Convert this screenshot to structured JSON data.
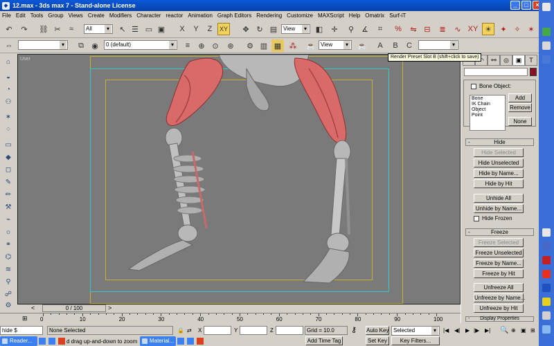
{
  "window": {
    "title": "12.max - 3ds max 7 - Stand-alone License",
    "app_icon": "3ds-max-icon"
  },
  "menu": [
    "File",
    "Edit",
    "Tools",
    "Group",
    "Views",
    "Create",
    "Modifiers",
    "Character",
    "reactor",
    "Animation",
    "Graph Editors",
    "Rendering",
    "Customize",
    "MAXScript",
    "Help",
    "Omatrix",
    "Surf-iT"
  ],
  "toolbar": {
    "selection_filter": "All",
    "ref_coord": "View",
    "layer": "0 (default)",
    "render_view": "View",
    "named_sel": "",
    "axis_x": "X",
    "axis_y": "Y",
    "axis_z": "Z",
    "axis_xy": "XY",
    "tooltip": "Render Preset Slot B (shift+click to save)"
  },
  "viewport": {
    "label": "User"
  },
  "command_panel": {
    "tab_icons": [
      "create-icon",
      "modify-icon",
      "hierarchy-icon",
      "motion-icon",
      "display-icon",
      "utilities-icon"
    ],
    "bone_object_label": "Bone Object:",
    "list_items": [
      "Bone",
      "IK Chain Object",
      "Point"
    ],
    "add": "Add",
    "remove": "Remove",
    "none": "None",
    "hide": {
      "title": "Hide",
      "hide_selected": "Hide Selected",
      "hide_unselected": "Hide Unselected",
      "hide_by_name": "Hide by Name...",
      "hide_by_hit": "Hide by Hit",
      "unhide_all": "Unhide All",
      "unhide_by_name": "Unhide by Name...",
      "hide_frozen": "Hide Frozen"
    },
    "freeze": {
      "title": "Freeze",
      "freeze_selected": "Freeze Selected",
      "freeze_unselected": "Freeze Unselected",
      "freeze_by_name": "Freeze by Name...",
      "freeze_by_hit": "Freeze by Hit",
      "unfreeze_all": "Unfreeze All",
      "unfreeze_by_name": "Unfreeze by Name...",
      "unfreeze_by_hit": "Unfreeze by Hit"
    },
    "display_properties": "Display Properties"
  },
  "timeline": {
    "slider": "0 / 100",
    "ticks": [
      "0",
      "10",
      "20",
      "30",
      "40",
      "50",
      "60",
      "70",
      "80",
      "90",
      "100"
    ]
  },
  "status": {
    "maxscript": "hide $",
    "selection": "None Selected",
    "x_label": "X",
    "x_value": "",
    "y_label": "Y",
    "y_value": "",
    "z_label": "Z",
    "z_value": "",
    "grid": "Grid = 10.0",
    "auto_key": "Auto Key",
    "key_mode": "Selected",
    "set_key": "Set Key",
    "key_filters": "Key Filters...",
    "add_time_tag": "Add Time Tag",
    "prompt": "d drag up-and-down to zoom"
  },
  "taskbar": {
    "item1": "Reader...",
    "item2": "Material..."
  }
}
